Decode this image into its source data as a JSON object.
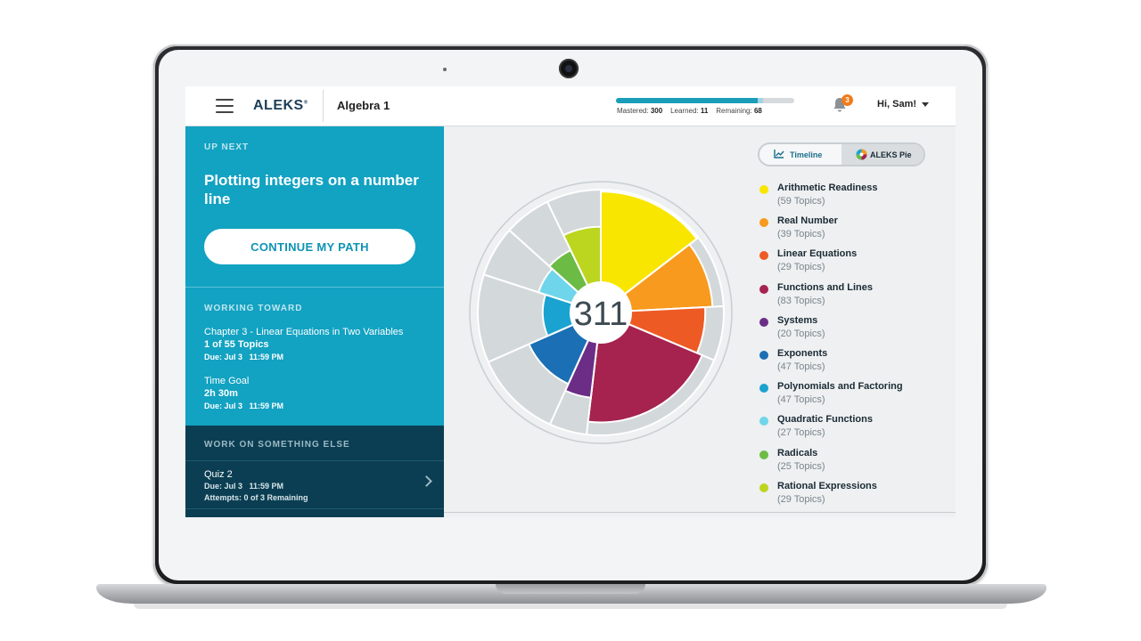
{
  "header": {
    "logo": "ALEKS",
    "logo_mark": "®",
    "course": "Algebra 1",
    "progress": {
      "mastered_label": "Mastered:",
      "mastered": "300",
      "learned_label": "Learned:",
      "learned": "11",
      "remaining_label": "Remaining:",
      "remaining": "68",
      "mastered_fraction": 0.794,
      "learned_fraction": 0.029
    },
    "notifications_count": "3",
    "user_greeting": "Hi, Sam!"
  },
  "up_next": {
    "label": "UP NEXT",
    "title": "Plotting integers on a number line",
    "cta": "CONTINUE MY PATH"
  },
  "working_toward": {
    "label": "WORKING TOWARD",
    "chapter": "Chapter 3 - Linear Equations in Two Variables",
    "chapter_progress": "1 of 55 Topics",
    "chapter_due": "Due: Jul 3   11:59 PM",
    "time_goal_label": "Time Goal",
    "time_goal": "2h 30m",
    "time_goal_due": "Due: Jul 3   11:59 PM"
  },
  "work_else": {
    "label": "WORK ON SOMETHING ELSE",
    "quiz_title": "Quiz 2",
    "quiz_due": "Due: Jul 3   11:59 PM",
    "quiz_attempts": "Attempts: 0 of 3 Remaining"
  },
  "view_toggle": {
    "timeline": "Timeline",
    "pie": "ALEKS Pie",
    "active": "ALEKS Pie"
  },
  "pie": {
    "center_value": "311"
  },
  "legend": [
    {
      "name": "Arithmetic Readiness",
      "count": "(59 Topics)",
      "color": "#f9e600"
    },
    {
      "name": "Real Number",
      "count": "(39 Topics)",
      "color": "#f79a1e"
    },
    {
      "name": "Linear Equations",
      "count": "(29 Topics)",
      "color": "#ee5a24"
    },
    {
      "name": "Functions and Lines",
      "count": "(83 Topics)",
      "color": "#a5234e"
    },
    {
      "name": "Systems",
      "count": "(20 Topics)",
      "color": "#6b2d86"
    },
    {
      "name": "Exponents",
      "count": "(47 Topics)",
      "color": "#1a6fb5"
    },
    {
      "name": "Polynomials and Factoring",
      "count": "(47 Topics)",
      "color": "#1aa3d1"
    },
    {
      "name": "Quadratic Functions",
      "count": "(27 Topics)",
      "color": "#6fd5ea"
    },
    {
      "name": "Radicals",
      "count": "(25 Topics)",
      "color": "#6cbb45"
    },
    {
      "name": "Rational Expressions",
      "count": "(29 Topics)",
      "color": "#bcd51f"
    }
  ],
  "colors": {
    "panel": "#12a2c2",
    "panel_dark": "#0b3e52",
    "pie_inactive": "#d3d8db"
  }
}
